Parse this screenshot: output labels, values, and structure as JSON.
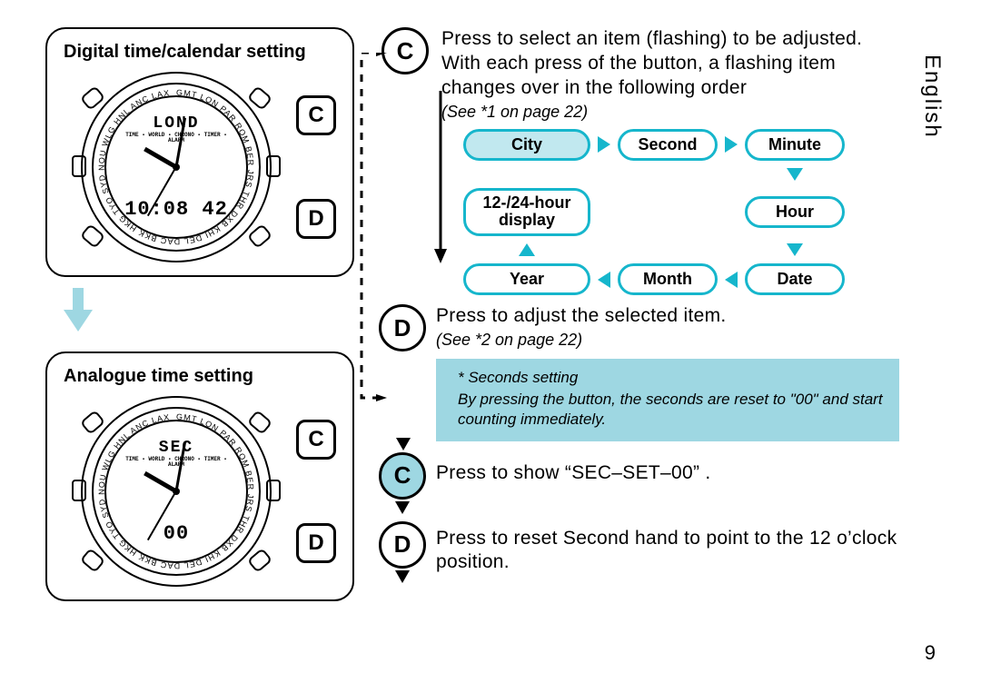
{
  "page_number": "9",
  "language_tab": "English",
  "left": {
    "digital": {
      "title": "Digital time/calendar setting",
      "btn_top": "C",
      "btn_bottom": "D",
      "lcd_top": "LOND",
      "lcd_main": "10:08 42"
    },
    "analogue": {
      "title": "Analogue time setting",
      "btn_top": "C",
      "btn_bottom": "D",
      "lcd_top": "SEC",
      "lcd_main": "00"
    }
  },
  "right": {
    "stepC": {
      "label": "C",
      "text": "Press to select an item (flashing) to be adjusted. With each press of the button, a flashing item changes over in the following order",
      "note": "(See *1 on page 22)"
    },
    "flow": {
      "city": "City",
      "second": "Second",
      "minute": "Minute",
      "hour": "Hour",
      "date": "Date",
      "month": "Month",
      "year": "Year",
      "display": "12-/24-hour\ndisplay"
    },
    "stepD": {
      "label": "D",
      "text": "Press to adjust the selected item.",
      "note": "(See *2 on page 22)"
    },
    "hint": {
      "title": "* Seconds setting",
      "body": "By pressing the button, the seconds are reset to \"00\"  and start counting immediately."
    },
    "stepC2": {
      "label": "C",
      "text": "Press to show “SEC–SET–00” ."
    },
    "stepD2": {
      "label": "D",
      "text": "Press to reset Second hand to point to the 12 o’clock position."
    }
  }
}
